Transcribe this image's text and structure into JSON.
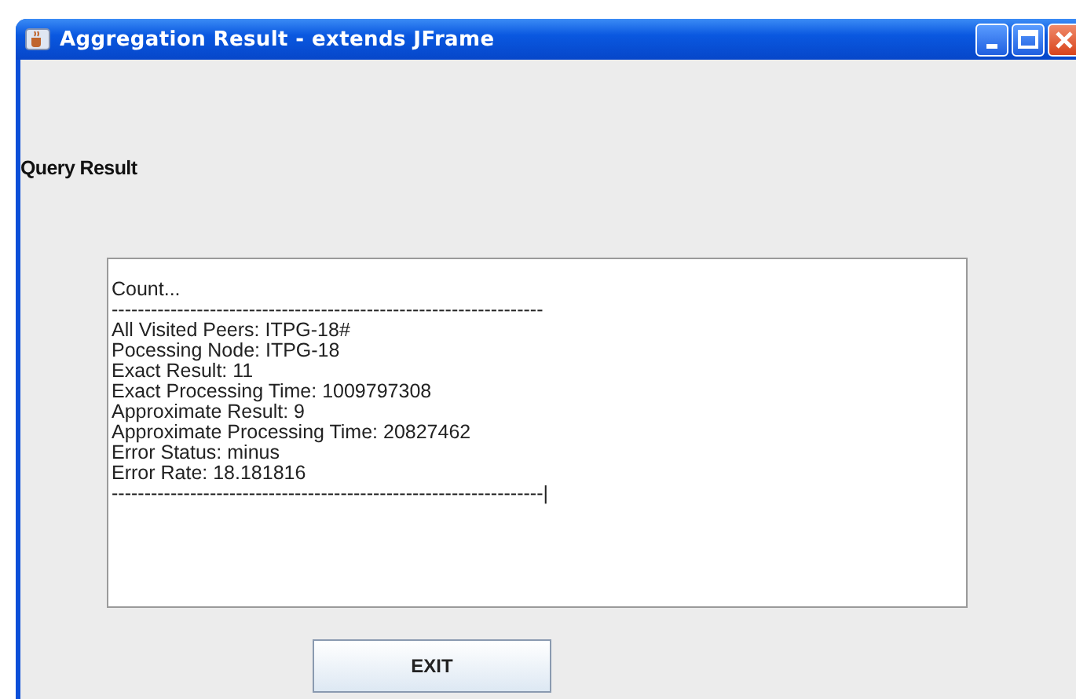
{
  "window": {
    "title": "Aggregation Result - extends JFrame"
  },
  "heading": "Query Result",
  "output": {
    "lines": [
      "Count...",
      "------------------------------------------------------------------",
      "All Visited Peers: ITPG-18#",
      "Pocessing Node: ITPG-18",
      "Exact Result: 11",
      "Exact Processing Time: 1009797308",
      "Approximate Result: 9",
      "Approximate Processing Time: 20827462",
      "Error Status: minus",
      "Error Rate: 18.181816",
      "------------------------------------------------------------------|"
    ]
  },
  "buttons": [
    "EXIT"
  ]
}
